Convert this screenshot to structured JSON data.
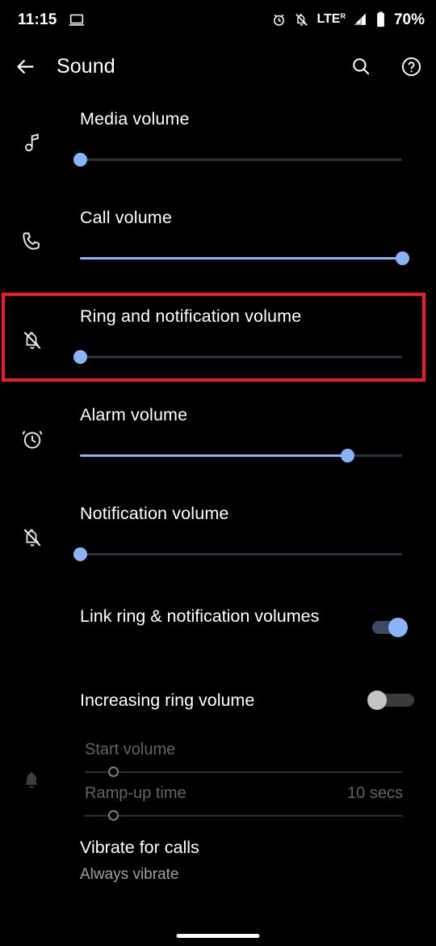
{
  "status_bar": {
    "time": "11:15",
    "left_icons": [
      "laptop-cast-icon"
    ],
    "right_icons": [
      "alarm-icon",
      "notifications-off-icon",
      "signal-icon"
    ],
    "network_label": "LTE",
    "roaming_label": "R",
    "battery_percent": "70%"
  },
  "app_bar": {
    "back_icon": "back-arrow-icon",
    "title": "Sound",
    "search_icon": "search-icon",
    "help_icon": "help-icon"
  },
  "colors": {
    "accent": "#8ab4f8",
    "track": "#2c3240",
    "highlight": "#ee1c25",
    "background": "#000000",
    "secondary_text": "#9aa0a6",
    "disabled_text": "#5f6368"
  },
  "sliders": [
    {
      "label": "Media volume",
      "icon": "music-note-icon",
      "value_percent": 0,
      "highlighted": false
    },
    {
      "label": "Call volume",
      "icon": "phone-icon",
      "value_percent": 100,
      "highlighted": false
    },
    {
      "label": "Ring and notification volume",
      "icon": "bell-off-icon",
      "value_percent": 0,
      "highlighted": true
    },
    {
      "label": "Alarm volume",
      "icon": "alarm-clock-icon",
      "value_percent": 83,
      "highlighted": false
    },
    {
      "label": "Notification volume",
      "icon": "bell-off-icon",
      "value_percent": 0,
      "highlighted": false
    }
  ],
  "toggles": [
    {
      "label": "Link ring & notification volumes",
      "state": "on"
    },
    {
      "label": "Increasing ring volume",
      "state": "off"
    }
  ],
  "increasing_ring_settings": {
    "icon": "bell-icon",
    "disabled": true,
    "start_volume": {
      "label": "Start volume",
      "value_percent": 9
    },
    "ramp_up_time": {
      "label": "Ramp-up time",
      "value": "10 secs",
      "value_percent": 9
    }
  },
  "vibrate_for_calls": {
    "title": "Vibrate for calls",
    "subtitle": "Always vibrate"
  }
}
